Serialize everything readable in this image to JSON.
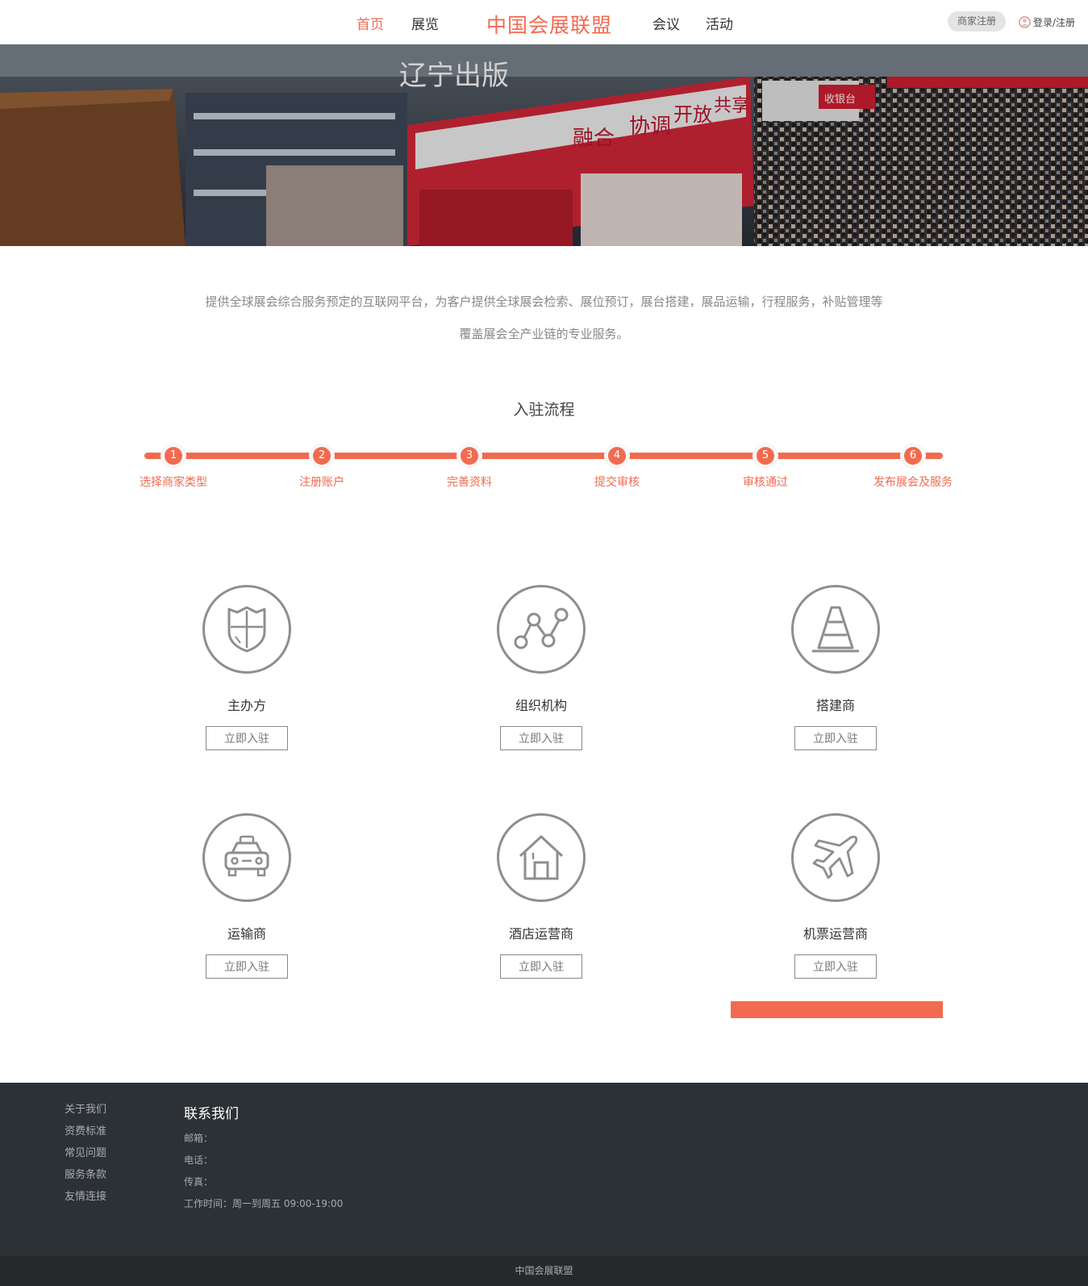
{
  "header": {
    "nav_left": [
      "首页",
      "展览"
    ],
    "brand": "中国会展联盟",
    "nav_right": [
      "会议",
      "活动"
    ],
    "merchant_register": "商家注册",
    "login": "登录/注册",
    "active_color": "#f26a4f"
  },
  "banner": {
    "signs": [
      "辽宁出版",
      "融合",
      "协调",
      "开放",
      "共享",
      "收银台"
    ]
  },
  "intro": {
    "line1": "提供全球展会综合服务预定的互联网平台，为客户提供全球展会检索、展位预订，展台搭建，展品运输，行程服务，补贴管理等",
    "line2": "覆盖展会全产业链的专业服务。"
  },
  "process": {
    "title": "入驻流程",
    "steps": [
      {
        "num": "1",
        "label": "选择商家类型"
      },
      {
        "num": "2",
        "label": "注册账户"
      },
      {
        "num": "3",
        "label": "完善资料"
      },
      {
        "num": "4",
        "label": "提交审核"
      },
      {
        "num": "5",
        "label": "审核通过"
      },
      {
        "num": "6",
        "label": "发布展会及服务"
      }
    ]
  },
  "cards": [
    {
      "name": "主办方",
      "icon": "shield-icon",
      "button": "立即入驻"
    },
    {
      "name": "组织机构",
      "icon": "network-icon",
      "button": "立即入驻"
    },
    {
      "name": "搭建商",
      "icon": "traffic-cone-icon",
      "button": "立即入驻"
    },
    {
      "name": "运输商",
      "icon": "taxi-icon",
      "button": "立即入驻"
    },
    {
      "name": "酒店运营商",
      "icon": "house-icon",
      "button": "立即入驻"
    },
    {
      "name": "机票运营商",
      "icon": "airplane-icon",
      "button": "立即入驻"
    }
  ],
  "footer": {
    "links": [
      "关于我们",
      "资费标准",
      "常见问题",
      "服务条款",
      "友情连接"
    ],
    "contact_title": "联系我们",
    "email": "邮箱：",
    "phone": "电话：",
    "fax": "传真：",
    "hours": "工作时间：周一到周五 09:00-19:00",
    "copyright": "中国会展联盟"
  },
  "colors": {
    "accent": "#f26a4f",
    "footer_bg": "#2c3135"
  }
}
